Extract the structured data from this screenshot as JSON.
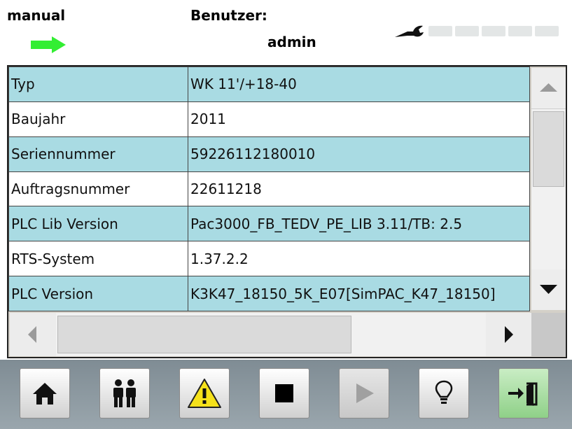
{
  "header": {
    "mode": "manual",
    "user_label": "Benutzer:",
    "user_name": "admin",
    "mode_arrow_color": "#33ee33",
    "status_led_count": 5
  },
  "table": {
    "rows": [
      {
        "label": "Typ",
        "value": "WK 11'/+18-40"
      },
      {
        "label": "Baujahr",
        "value": "2011"
      },
      {
        "label": "Seriennummer",
        "value": "59226112180010"
      },
      {
        "label": "Auftragsnummer",
        "value": "22611218"
      },
      {
        "label": "PLC Lib Version",
        "value": "Pac3000_FB_TEDV_PE_LIB 3.11/TB: 2.5"
      },
      {
        "label": "RTS-System",
        "value": "1.37.2.2"
      },
      {
        "label": "PLC Version",
        "value": "K3K47_18150_5K_E07[SimPAC_K47_18150]"
      }
    ],
    "row_colors": {
      "alt": "#a9dbe3",
      "plain": "#ffffff"
    }
  },
  "toolbar": {
    "buttons": [
      {
        "icon": "home-icon"
      },
      {
        "icon": "users-icon"
      },
      {
        "icon": "warning-icon"
      },
      {
        "icon": "stop-icon"
      },
      {
        "icon": "play-icon",
        "state": "disabled"
      },
      {
        "icon": "lightbulb-icon"
      },
      {
        "icon": "exit-door-icon",
        "state": "active"
      }
    ]
  }
}
